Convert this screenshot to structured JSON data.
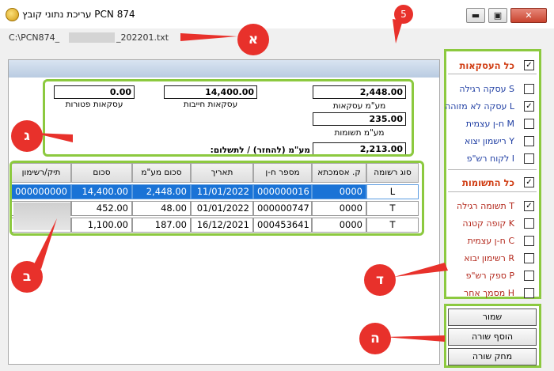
{
  "window": {
    "title": "PCN 874 עריכת נתוני קובץ",
    "file_path_start": "C:\\PCN874_",
    "file_path_end": "_202201.txt",
    "controls": {
      "minimize": "▬",
      "maximize": "▣",
      "close": "✕"
    }
  },
  "annotations": {
    "aleph": "א",
    "gimel": "ג",
    "bet": "ב",
    "dalet": "ד",
    "he": "ה",
    "five": "5"
  },
  "totals": {
    "vat_deals_label": "מע\"מ עסקאות",
    "vat_deals_value": "2,448.00",
    "taxable_deals_label": "עסקאות חייבות",
    "taxable_deals_value": "14,400.00",
    "exempt_deals_label": "עסקאות פטורות",
    "exempt_deals_value": "0.00",
    "vat_inputs_label": "מע\"מ תשומות",
    "vat_inputs_value": "235.00",
    "vat_payable_label": "מע\"מ (להחזר) / לתשלום:",
    "vat_payable_value": "2,213.00"
  },
  "table": {
    "columns": [
      "סוג רשומה",
      "ק. אסמכתא",
      "מספר ח-ן",
      "תאריך",
      "סכום מע\"מ",
      "סכום",
      "תיק/רשימון"
    ],
    "rows": [
      {
        "type": "L",
        "ref": "0000",
        "account": "000000016",
        "date": "11/01/2022",
        "vat": "2,448.00",
        "amount": "14,400.00",
        "file": "000000000"
      },
      {
        "type": "T",
        "ref": "0000",
        "account": "000000747",
        "date": "01/01/2022",
        "vat": "48.00",
        "amount": "452.00",
        "file": ""
      },
      {
        "type": "T",
        "ref": "0000",
        "account": "000453641",
        "date": "16/12/2021",
        "vat": "187.00",
        "amount": "1,100.00",
        "file": ""
      }
    ]
  },
  "filters": {
    "all_deals": "כל העסקאות",
    "deal_items": [
      "S עסקה רגילה",
      "L עסקה לא מזוהה",
      "M ח-ן עצמית",
      "Y רישמון יצוא",
      "I לקוח רש\"פ"
    ],
    "deal_checked": [
      false,
      true,
      false,
      false,
      false
    ],
    "all_inputs": "כל התשומות",
    "input_items": [
      "T תשומה רגילה",
      "K קופה קטנה",
      "C ח-ן עצמית",
      "R רשימון יבוא",
      "P ספק רש\"פ",
      "H מסמך אחר"
    ],
    "input_checked": [
      true,
      false,
      false,
      false,
      false,
      false
    ],
    "check_mark": "✓"
  },
  "actions": {
    "save": "שמור",
    "add_row": "הוסף שורה",
    "delete_row": "מחק שורה"
  },
  "colors": {
    "annotation_red": "#e8312b",
    "highlight_green": "#8cc93f",
    "selection_blue": "#1a73d6"
  }
}
